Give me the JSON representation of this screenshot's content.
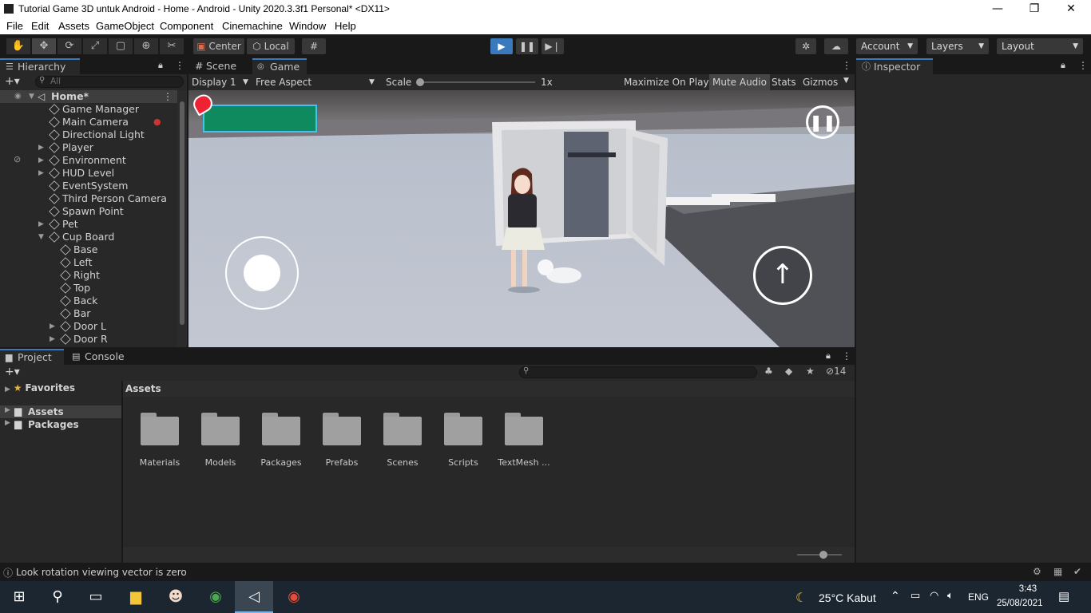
{
  "window": {
    "title": "Tutorial Game 3D untuk Android - Home - Android - Unity 2020.3.3f1 Personal* <DX11>",
    "minimize": "—",
    "restore": "❐",
    "close": "✕"
  },
  "menu": [
    "File",
    "Edit",
    "Assets",
    "GameObject",
    "Component",
    "Cinemachine",
    "Window",
    "Help"
  ],
  "toolbar": {
    "pivot_center": "Center",
    "pivot_local": "Local",
    "account": "Account",
    "layers": "Layers",
    "layout": "Layout"
  },
  "hierarchy": {
    "tab": "Hierarchy",
    "search_placeholder": "All",
    "scene": "Home*",
    "items": [
      {
        "label": "Game Manager",
        "indent": 1,
        "fold": false
      },
      {
        "label": "Main Camera",
        "indent": 1,
        "fold": false
      },
      {
        "label": "Directional Light",
        "indent": 1,
        "fold": false
      },
      {
        "label": "Player",
        "indent": 1,
        "fold": "closed"
      },
      {
        "label": "Environment",
        "indent": 1,
        "fold": "closed"
      },
      {
        "label": "HUD Level",
        "indent": 1,
        "fold": "closed"
      },
      {
        "label": "EventSystem",
        "indent": 1,
        "fold": false
      },
      {
        "label": "Third Person Camera",
        "indent": 1,
        "fold": false
      },
      {
        "label": "Spawn Point",
        "indent": 1,
        "fold": false
      },
      {
        "label": "Pet",
        "indent": 1,
        "fold": "closed"
      },
      {
        "label": "Cup Board",
        "indent": 1,
        "fold": "open"
      },
      {
        "label": "Base",
        "indent": 2,
        "fold": false
      },
      {
        "label": "Left",
        "indent": 2,
        "fold": false
      },
      {
        "label": "Right",
        "indent": 2,
        "fold": false
      },
      {
        "label": "Top",
        "indent": 2,
        "fold": false
      },
      {
        "label": "Back",
        "indent": 2,
        "fold": false
      },
      {
        "label": "Bar",
        "indent": 2,
        "fold": false
      },
      {
        "label": "Door L",
        "indent": 2,
        "fold": "closed"
      },
      {
        "label": "Door R",
        "indent": 2,
        "fold": "closed"
      }
    ]
  },
  "game": {
    "tab_scene": "Scene",
    "tab_game": "Game",
    "display": "Display 1",
    "aspect": "Free Aspect",
    "scale_label": "Scale",
    "scale_value": "1x",
    "maximize": "Maximize On Play",
    "mute": "Mute Audio",
    "stats": "Stats",
    "gizmos": "Gizmos",
    "health_fraction": 1.0
  },
  "inspector": {
    "tab": "Inspector"
  },
  "project": {
    "tab_project": "Project",
    "tab_console": "Console",
    "hidden_count": "14",
    "favorites": "Favorites",
    "assets": "Assets",
    "packages": "Packages",
    "breadcrumb": "Assets",
    "folders": [
      "Materials",
      "Models",
      "Packages",
      "Prefabs",
      "Scenes",
      "Scripts",
      "TextMesh ..."
    ]
  },
  "status": {
    "message": "Look rotation viewing vector is zero"
  },
  "taskbar": {
    "weather": "25°C  Kabut",
    "lang": "ENG",
    "time": "3:43",
    "date": "25/08/2021"
  },
  "colors": {
    "accent": "#3a79bb",
    "health_bar": "#0f8a5f",
    "play_active": "#3a79bb"
  }
}
